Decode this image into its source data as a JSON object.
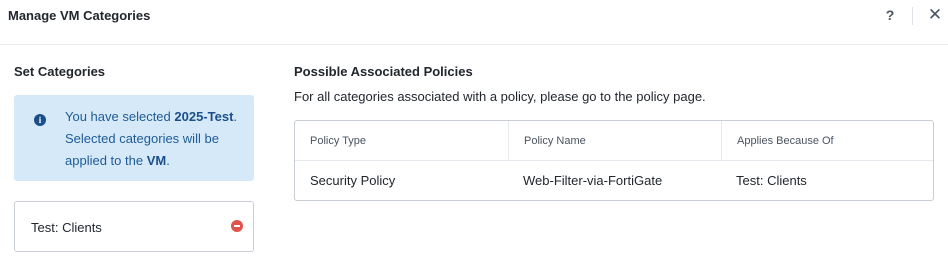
{
  "header": {
    "title": "Manage VM Categories",
    "help_label": "?",
    "close_label": "✕"
  },
  "left": {
    "title": "Set Categories",
    "info": {
      "icon_glyph": "i",
      "text_prefix": "You have selected ",
      "selected_name": "2025-Test",
      "text_middle": ". Selected categories will be applied to the ",
      "target": "VM",
      "text_suffix": "."
    },
    "categories": [
      {
        "label": "Test: Clients"
      }
    ]
  },
  "right": {
    "title": "Possible Associated Policies",
    "description": "For all categories associated with a policy, please go to the policy page.",
    "table": {
      "columns": [
        "Policy Type",
        "Policy Name",
        "Applies Because Of"
      ],
      "rows": [
        [
          "Security Policy",
          "Web-Filter-via-FortiGate",
          "Test: Clients"
        ]
      ]
    }
  },
  "colors": {
    "info_background": "#d5e9f9",
    "info_text": "#1f5b96",
    "remove_icon": "#e0544b"
  }
}
